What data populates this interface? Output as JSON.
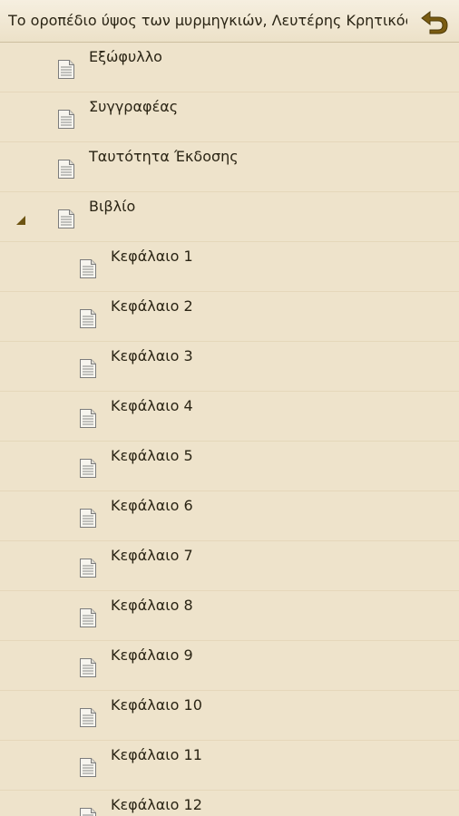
{
  "header": {
    "title": "Το οροπέδιο ύψος των μυρμηγκιών, Λευτέρης Κρητικός",
    "back_icon": "back-arrow-icon",
    "accent_color": "#7a5c12"
  },
  "toc": {
    "icon": "document-icon",
    "expander_icon": "expanded-triangle-icon",
    "items": [
      {
        "label": "Εξώφυλλο",
        "level": 0
      },
      {
        "label": "Συγγραφέας",
        "level": 0
      },
      {
        "label": "Ταυτότητα Έκδοσης",
        "level": 0
      },
      {
        "label": "Βιβλίο",
        "level": 0,
        "expanded": true
      },
      {
        "label": "Κεφάλαιο 1",
        "level": 1
      },
      {
        "label": "Κεφάλαιο 2",
        "level": 1
      },
      {
        "label": "Κεφάλαιο 3",
        "level": 1
      },
      {
        "label": "Κεφάλαιο 4",
        "level": 1
      },
      {
        "label": "Κεφάλαιο 5",
        "level": 1
      },
      {
        "label": "Κεφάλαιο 6",
        "level": 1
      },
      {
        "label": "Κεφάλαιο 7",
        "level": 1
      },
      {
        "label": "Κεφάλαιο 8",
        "level": 1
      },
      {
        "label": "Κεφάλαιο 9",
        "level": 1
      },
      {
        "label": "Κεφάλαιο 10",
        "level": 1
      },
      {
        "label": "Κεφάλαιο 11",
        "level": 1
      },
      {
        "label": "Κεφάλαιο 12",
        "level": 1
      }
    ]
  }
}
